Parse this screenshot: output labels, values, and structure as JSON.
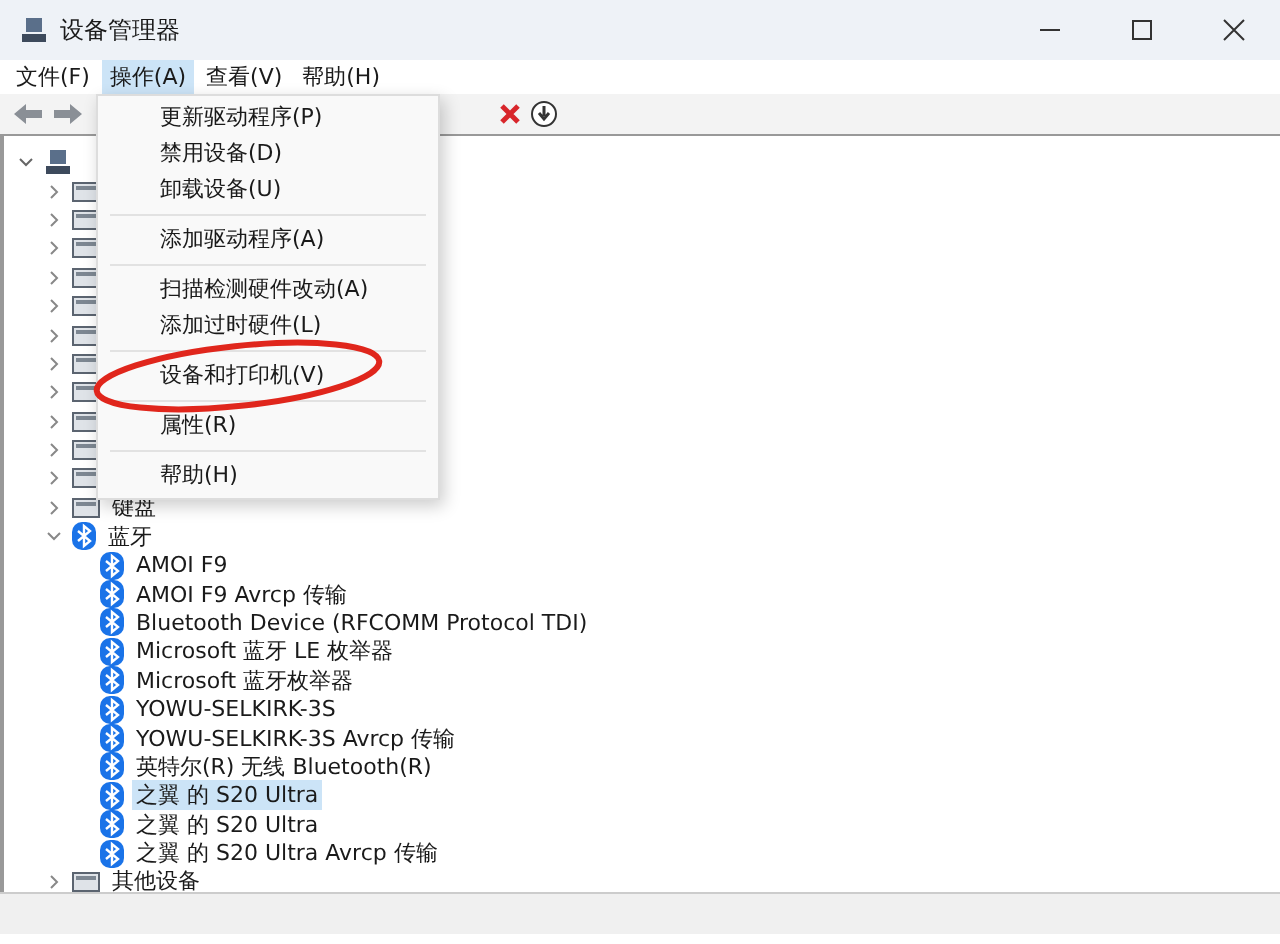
{
  "window": {
    "title": "设备管理器"
  },
  "menu_bar": [
    {
      "label": "文件(F)",
      "selected": false
    },
    {
      "label": "操作(A)",
      "selected": true
    },
    {
      "label": "查看(V)",
      "selected": false
    },
    {
      "label": "帮助(H)",
      "selected": false
    }
  ],
  "open_menu": {
    "items": [
      {
        "label": "更新驱动程序(P)",
        "separator_before": false
      },
      {
        "label": "禁用设备(D)",
        "separator_before": false
      },
      {
        "label": "卸载设备(U)",
        "separator_before": false
      },
      {
        "label": "添加驱动程序(A)",
        "separator_before": true
      },
      {
        "label": "扫描检测硬件改动(A)",
        "separator_before": true
      },
      {
        "label": "添加过时硬件(L)",
        "separator_before": false
      },
      {
        "label": "设备和打印机(V)",
        "separator_before": true
      },
      {
        "label": "属性(R)",
        "separator_before": true
      },
      {
        "label": "帮助(H)",
        "separator_before": true
      }
    ]
  },
  "tree": {
    "expanded": true,
    "children": [
      {
        "expanded": false
      },
      {
        "expanded": false
      },
      {
        "expanded": false
      },
      {
        "expanded": false
      },
      {
        "expanded": false
      },
      {
        "expanded": false
      },
      {
        "expanded": false
      },
      {
        "expanded": false
      },
      {
        "expanded": false
      },
      {
        "expanded": false
      },
      {
        "expanded": false
      },
      {
        "label": "键盘",
        "expanded": false
      },
      {
        "label": "蓝牙",
        "expanded": true,
        "children": [
          {
            "label": "AMOI F9",
            "selected": false
          },
          {
            "label": "AMOI F9 Avrcp 传输",
            "selected": false
          },
          {
            "label": "Bluetooth Device (RFCOMM Protocol TDI)",
            "selected": false
          },
          {
            "label": "Microsoft 蓝牙 LE 枚举器",
            "selected": false
          },
          {
            "label": "Microsoft 蓝牙枚举器",
            "selected": false
          },
          {
            "label": "YOWU-SELKIRK-3S",
            "selected": false
          },
          {
            "label": "YOWU-SELKIRK-3S Avrcp 传输",
            "selected": false
          },
          {
            "label": "英特尔(R) 无线 Bluetooth(R)",
            "selected": false
          },
          {
            "label": "之翼 的 S20 Ultra",
            "selected": true
          },
          {
            "label": "之翼 的 S20 Ultra",
            "selected": false
          },
          {
            "label": "之翼 的 S20 Ultra Avrcp 传输",
            "selected": false
          }
        ]
      },
      {
        "label": "其他设备",
        "expanded": false
      }
    ]
  }
}
